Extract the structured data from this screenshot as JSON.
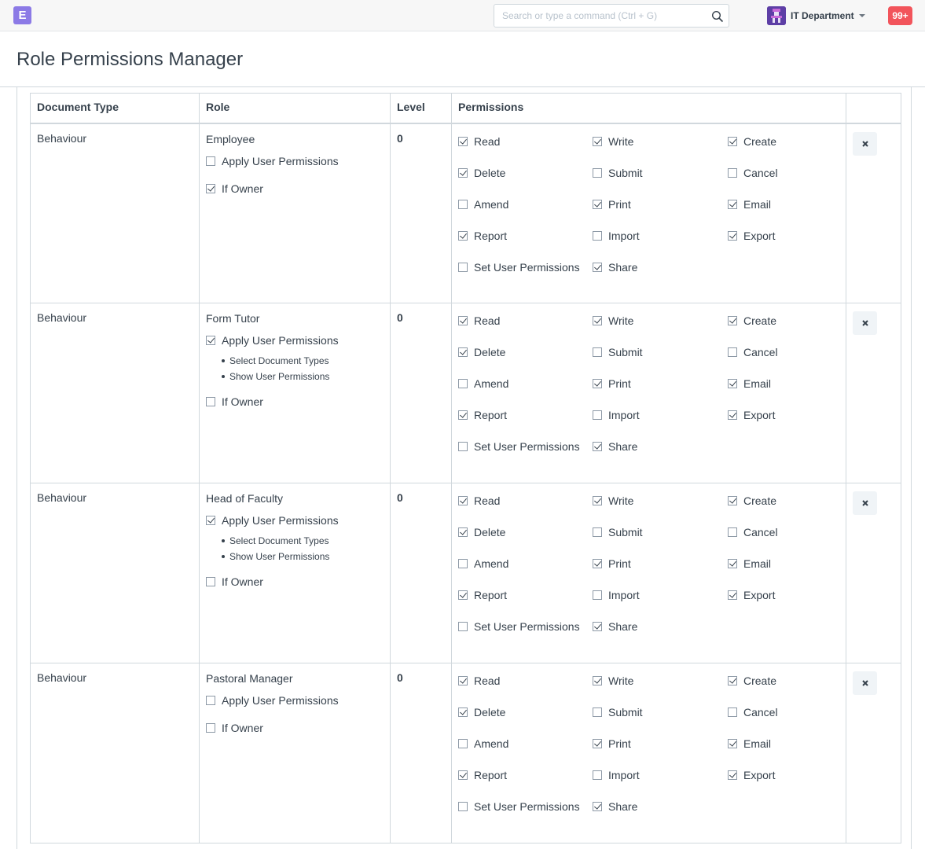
{
  "navbar": {
    "logo_letter": "E",
    "search_placeholder": "Search or type a command (Ctrl + G)",
    "user_name": "IT Department",
    "notification_count": "99+"
  },
  "page": {
    "title": "Role Permissions Manager"
  },
  "table": {
    "headers": [
      "Document Type",
      "Role",
      "Level",
      "Permissions"
    ],
    "apply_user_permissions_label": "Apply User Permissions",
    "if_owner_label": "If Owner",
    "sub_links": [
      "Select Document Types",
      "Show User Permissions"
    ],
    "permission_labels": [
      "Read",
      "Write",
      "Create",
      "Delete",
      "Submit",
      "Cancel",
      "Amend",
      "Print",
      "Email",
      "Report",
      "Import",
      "Export",
      "Set User Permissions",
      "Share"
    ],
    "rows": [
      {
        "doctype": "Behaviour",
        "role": "Employee",
        "level": "0",
        "apply_user_permissions": false,
        "if_owner": true,
        "permissions": [
          true,
          true,
          true,
          true,
          false,
          false,
          false,
          true,
          true,
          true,
          false,
          true,
          false,
          true
        ]
      },
      {
        "doctype": "Behaviour",
        "role": "Form Tutor",
        "level": "0",
        "apply_user_permissions": true,
        "if_owner": false,
        "permissions": [
          true,
          true,
          true,
          true,
          false,
          false,
          false,
          true,
          true,
          true,
          false,
          true,
          false,
          true
        ]
      },
      {
        "doctype": "Behaviour",
        "role": "Head of Faculty",
        "level": "0",
        "apply_user_permissions": true,
        "if_owner": false,
        "permissions": [
          true,
          true,
          true,
          true,
          false,
          false,
          false,
          true,
          true,
          true,
          false,
          true,
          false,
          true
        ]
      },
      {
        "doctype": "Behaviour",
        "role": "Pastoral Manager",
        "level": "0",
        "apply_user_permissions": false,
        "if_owner": false,
        "permissions": [
          true,
          true,
          true,
          true,
          false,
          false,
          false,
          true,
          true,
          true,
          false,
          true,
          false,
          true
        ]
      }
    ]
  }
}
